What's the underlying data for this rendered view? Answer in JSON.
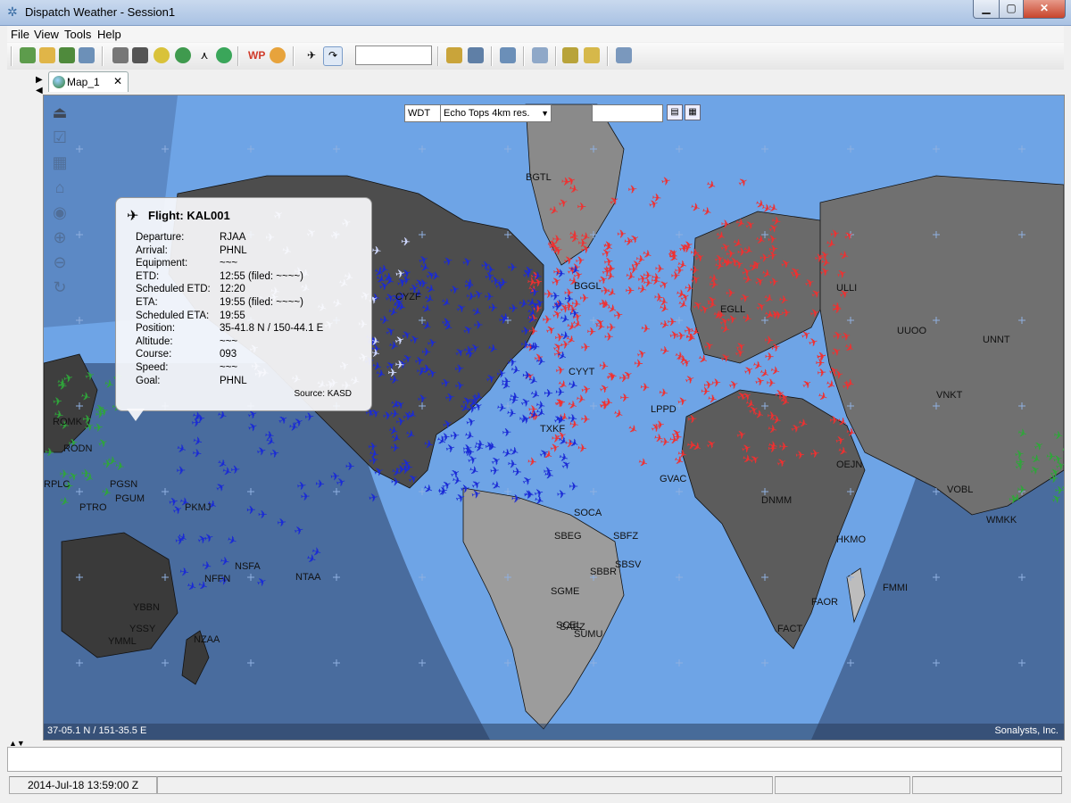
{
  "window": {
    "title": "Dispatch Weather - Session1",
    "min_label": "▁",
    "max_label": "▢",
    "close_label": "✕"
  },
  "menu": [
    "File",
    "View",
    "Tools",
    "Help"
  ],
  "tab": {
    "label": "Map_1",
    "close": "✕"
  },
  "map_controls": {
    "wdt": "WDT",
    "layer": "Echo Tops 4km res.",
    "search_value": ""
  },
  "popup": {
    "title": "Flight: KAL001",
    "rows": [
      {
        "k": "Departure:",
        "v": "RJAA"
      },
      {
        "k": "Arrival:",
        "v": "PHNL"
      },
      {
        "k": "Equipment:",
        "v": "~~~"
      },
      {
        "k": "ETD:",
        "v": "12:55  (filed: ~~~~)"
      },
      {
        "k": "Scheduled ETD:",
        "v": "12:20"
      },
      {
        "k": "ETA:",
        "v": "19:55  (filed: ~~~~)"
      },
      {
        "k": "Scheduled ETA:",
        "v": "19:55"
      },
      {
        "k": "Position:",
        "v": "35-41.8 N / 150-44.1 E"
      },
      {
        "k": "Altitude:",
        "v": "~~~"
      },
      {
        "k": "Course:",
        "v": "093"
      },
      {
        "k": "Speed:",
        "v": "~~~"
      },
      {
        "k": "Goal:",
        "v": "PHNL"
      }
    ],
    "source": "Source: KASD"
  },
  "coords": "37-05.1 N / 151-35.5 E",
  "credit": "Sonalysts, Inc.",
  "airports": [
    {
      "code": "BGTL"
    },
    {
      "code": "CYZF"
    },
    {
      "code": "ROMK"
    },
    {
      "code": "PGSN"
    },
    {
      "code": "PGUM"
    },
    {
      "code": "PTRO"
    },
    {
      "code": "RPLC"
    },
    {
      "code": "PKMJ"
    },
    {
      "code": "NSFA"
    },
    {
      "code": "NFFN"
    },
    {
      "code": "NTAA"
    },
    {
      "code": "YBBN"
    },
    {
      "code": "YSSY"
    },
    {
      "code": "YMML"
    },
    {
      "code": "NZAA"
    },
    {
      "code": "TXKF"
    },
    {
      "code": "SOCA"
    },
    {
      "code": "SBFZ"
    },
    {
      "code": "SBEG"
    },
    {
      "code": "SBBR"
    },
    {
      "code": "SBSV"
    },
    {
      "code": "SCEL"
    },
    {
      "code": "SGME"
    },
    {
      "code": "SUMU"
    },
    {
      "code": "SAEZ"
    },
    {
      "code": "LPPD"
    },
    {
      "code": "GVAC"
    },
    {
      "code": "DNMM"
    },
    {
      "code": "FMMI"
    },
    {
      "code": "FAOR"
    },
    {
      "code": "FACT"
    },
    {
      "code": "VOBL"
    },
    {
      "code": "VNKT"
    },
    {
      "code": "UUOO"
    },
    {
      "code": "ULLI"
    },
    {
      "code": "UNNT"
    },
    {
      "code": "OEJN"
    },
    {
      "code": "HKMO"
    },
    {
      "code": "WMKK"
    },
    {
      "code": "EGLL"
    },
    {
      "code": "CYYT"
    },
    {
      "code": "RODN"
    },
    {
      "code": "BGGL"
    }
  ],
  "status": {
    "datetime": "2014-Jul-18 13:59:00 Z"
  },
  "icons": {
    "plane_colors": {
      "atlantic": "#f03030",
      "americas": "#1a2ad6",
      "asia": "#2fa63a",
      "pacific": "#cfd8ff"
    }
  }
}
